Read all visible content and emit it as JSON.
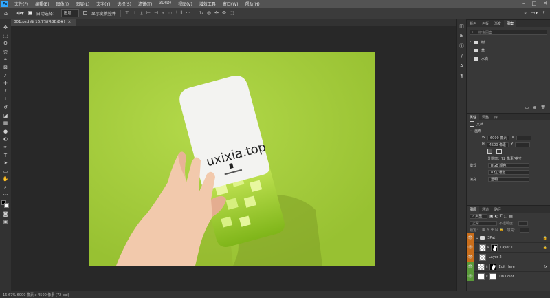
{
  "app": {
    "logo": "Ps"
  },
  "menu": [
    "文件(F)",
    "编辑(E)",
    "图像(I)",
    "图层(L)",
    "文字(Y)",
    "选择(S)",
    "滤镜(T)",
    "3D(D)",
    "视图(V)",
    "增效工具",
    "窗口(W)",
    "帮助(H)"
  ],
  "options": {
    "auto_select": "自动选择：",
    "target": "图层",
    "show_transform": "显示变换控件"
  },
  "document": {
    "tab": "001.psd @ 16.7%(RGB/8#)",
    "close": "×"
  },
  "photo": {
    "card_text": "uxixia.top",
    "colors": {
      "background": "#a7cf3d",
      "card": "#f3f3f1"
    }
  },
  "status": {
    "text": "16.67%   6000 像素 x 4500 像素 (72 ppi)"
  },
  "libraries": {
    "tabs": [
      "颜色",
      "色板",
      "渐变",
      "图案"
    ],
    "search_placeholder": "搜索图案",
    "items": [
      "树",
      "草",
      "水滴"
    ]
  },
  "properties": {
    "tabs": [
      "属性",
      "调整",
      "库"
    ],
    "doc_label": "文档",
    "section": "画布",
    "width_label": "W",
    "width_value": "6000 像素",
    "x_label": "X",
    "height_label": "H",
    "height_value": "4500 像素",
    "y_label": "Y",
    "resolution": "分辨率：72 像素/英寸",
    "mode_label": "模式",
    "mode_value": "RGB 颜色",
    "depth_value": "8 位/通道",
    "fill_label": "填充",
    "fill_value": "透明"
  },
  "layers": {
    "tabs": [
      "图层",
      "通道",
      "路径"
    ],
    "filter_kind": "类型",
    "blend_mode": "正常",
    "opacity_label": "不透明度：",
    "lock_label": "锁定：",
    "fill_label": "填充：",
    "items": [
      {
        "name": "3Pat",
        "type": "group"
      },
      {
        "name": "Layer 1",
        "type": "masked"
      },
      {
        "name": "Layer 2",
        "type": "pixel"
      },
      {
        "name": "Edit Here",
        "type": "smart"
      },
      {
        "name": "Tin Color",
        "type": "fill"
      }
    ]
  }
}
